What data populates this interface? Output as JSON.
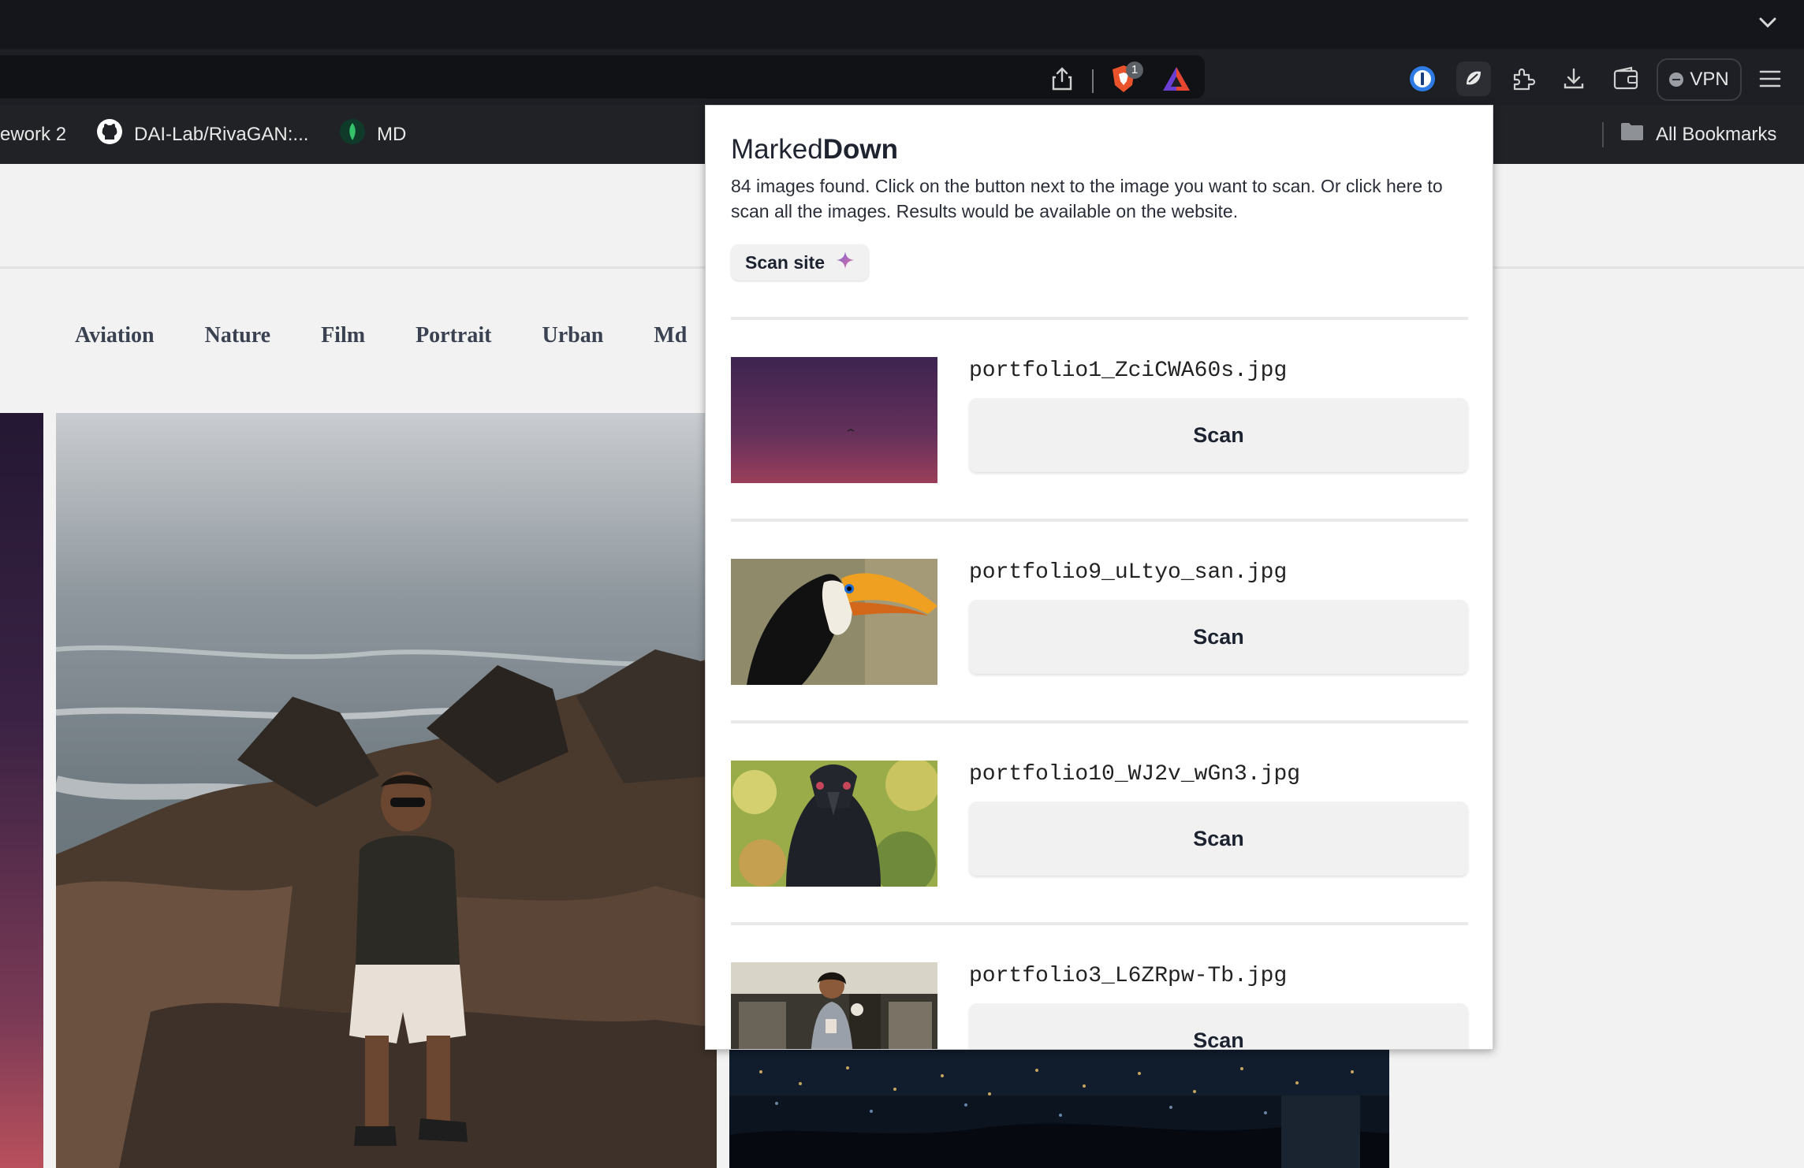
{
  "browser": {
    "vpn_label": "VPN",
    "shields_badge": "1",
    "bookmarks": [
      {
        "label": "ework 2",
        "icon": "none"
      },
      {
        "label": "DAI-Lab/RivaGAN:...",
        "icon": "github-icon"
      },
      {
        "label": "MD",
        "icon": "leaf-icon"
      }
    ],
    "all_bookmarks_label": "All Bookmarks"
  },
  "page": {
    "nav": [
      "Aviation",
      "Nature",
      "Film",
      "Portrait",
      "Urban",
      "Md"
    ]
  },
  "popup": {
    "title_light": "Marked",
    "title_bold": "Down",
    "description": "84 images found. Click on the button next to the image you want to scan. Or click here to scan all the images. Results would be available on the website.",
    "scan_site_label": "Scan site",
    "items": [
      {
        "filename": "portfolio1_ZciCWA60s.jpg",
        "button": "Scan"
      },
      {
        "filename": "portfolio9_uLtyo_san.jpg",
        "button": "Scan"
      },
      {
        "filename": "portfolio10_WJ2v_wGn3.jpg",
        "button": "Scan"
      },
      {
        "filename": "portfolio3_L6ZRpw-Tb.jpg",
        "button": "Scan"
      }
    ]
  },
  "colors": {
    "chrome_dark": "#14161b",
    "popup_bg": "#ffffff",
    "button_bg": "#f1f1f1",
    "scan_site_sparkle": "#9a6fcf"
  }
}
